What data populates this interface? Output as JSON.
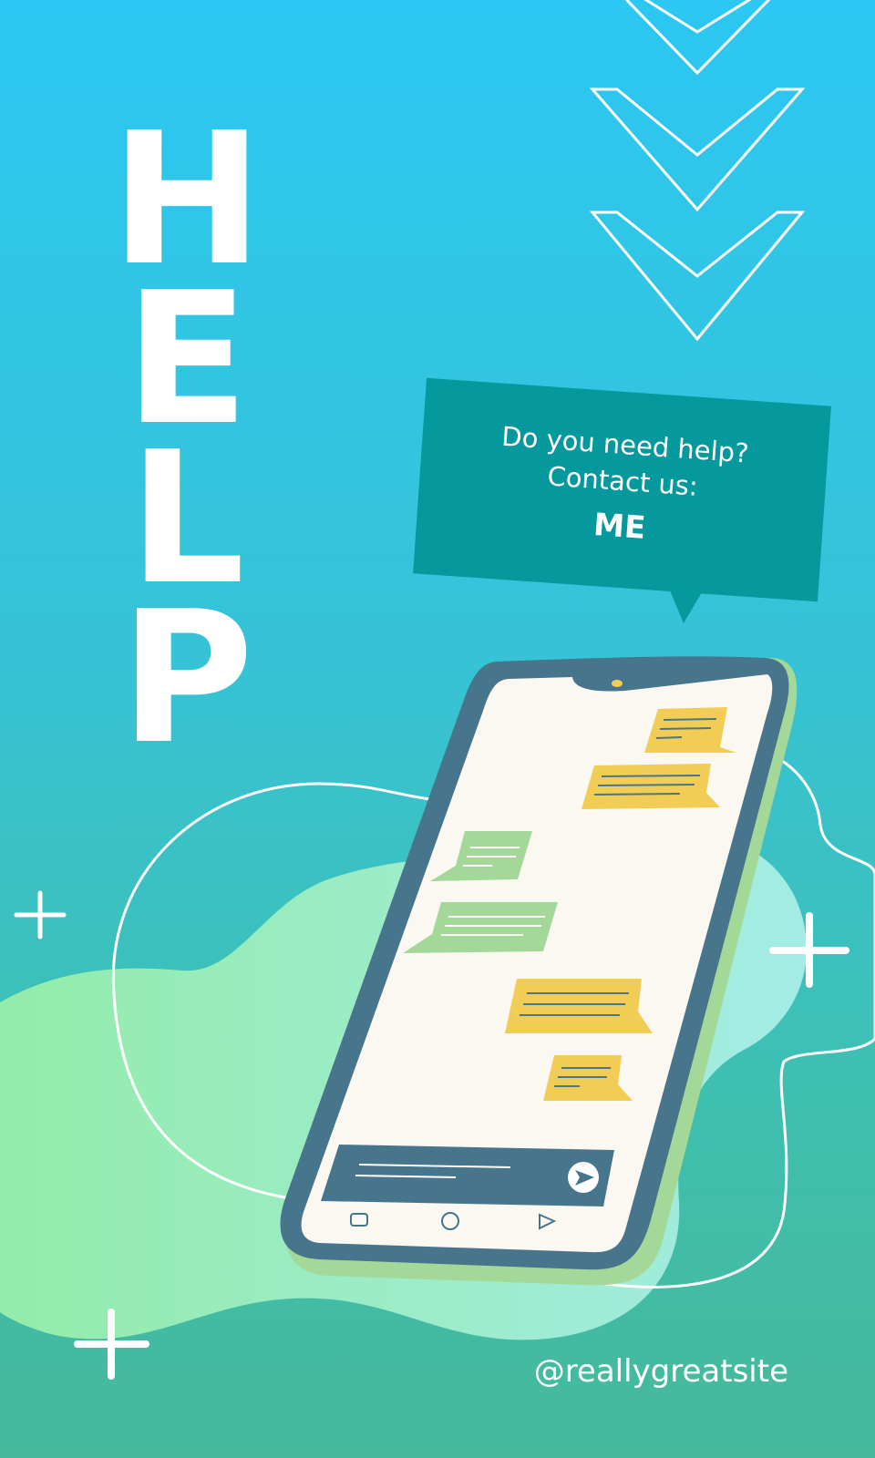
{
  "headline": {
    "letters": [
      "H",
      "E",
      "L",
      "P"
    ]
  },
  "speech_bubble": {
    "line1": "Do you need help?",
    "line2": "Contact us:",
    "contact": "ME"
  },
  "footer": {
    "handle": "@reallygreatsite"
  },
  "icons": [
    "chevron-down-icon",
    "plus-sparkle-icon",
    "smartphone-illustration",
    "send-icon"
  ],
  "colors": {
    "background_top": "#2cc7f2",
    "background_bottom": "#45b99a",
    "bubble": "#05999d",
    "phone_frame": "#46758c",
    "phone_screen": "#fbf7f1",
    "chat_yellow": "#f2cd55",
    "chat_green": "#a4d898",
    "blob_green": "#93ecb4"
  }
}
